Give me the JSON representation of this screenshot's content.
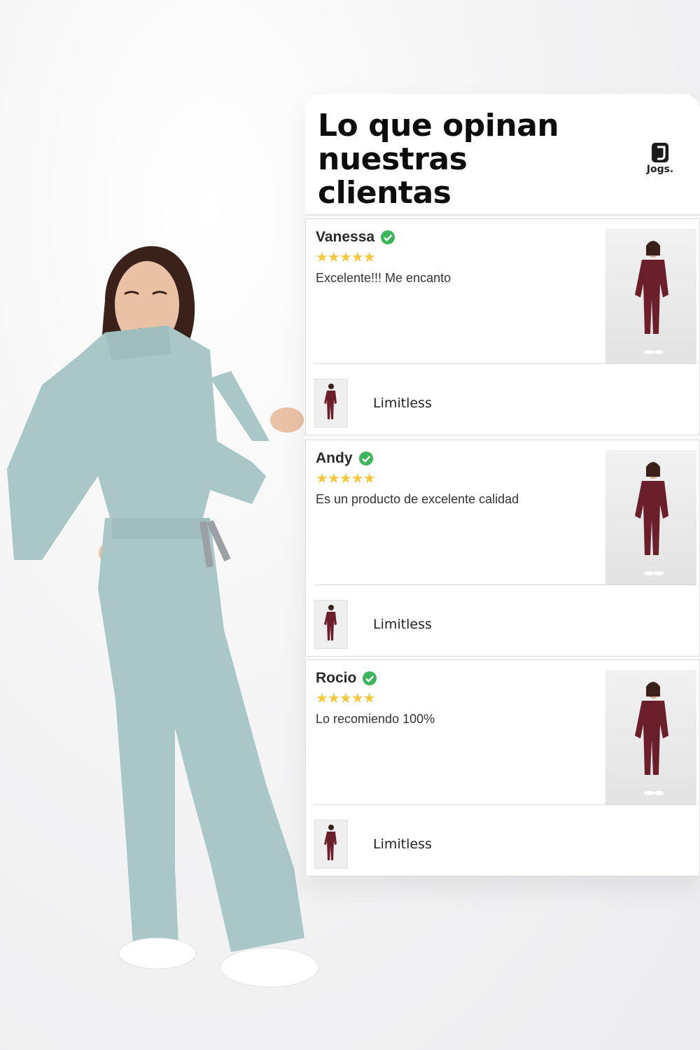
{
  "header": {
    "title_lines": [
      "Lo que opinan",
      "nuestras",
      "clientas"
    ],
    "brand_name": "Jogs."
  },
  "reviews": [
    {
      "name": "Vanessa",
      "stars": "★★★★★",
      "rating": 5,
      "text": "Excelente!!! Me encanto",
      "product": "Limitless"
    },
    {
      "name": "Andy",
      "stars": "★★★★★",
      "rating": 5,
      "text": "Es un producto de excelente calidad",
      "product": "Limitless"
    },
    {
      "name": "Rocio",
      "stars": "★★★★★",
      "rating": 5,
      "text": "Lo recomiendo 100%",
      "product": "Limitless"
    }
  ],
  "colors": {
    "scrub_model": "#a9c7c6",
    "scrub_review": "#6b1f2a",
    "star": "#f5c73b",
    "verified": "#3cb55b"
  }
}
